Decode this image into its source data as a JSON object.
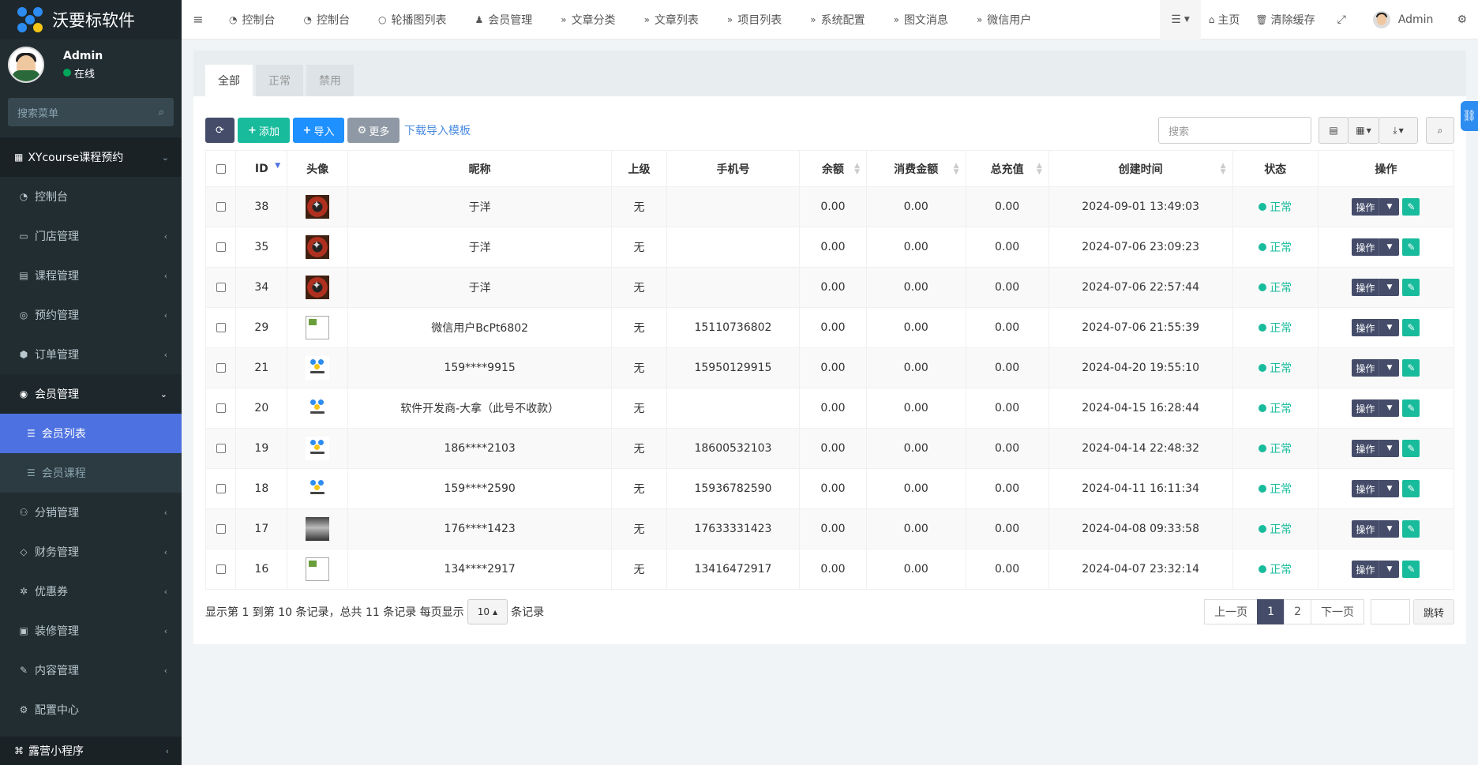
{
  "app": {
    "title": "沃要标软件"
  },
  "user": {
    "name": "Admin",
    "status": "在线"
  },
  "sidebar": {
    "search_placeholder": "搜索菜单",
    "header": "XYcourse课程预约",
    "items": [
      {
        "label": "控制台",
        "icon": "dashboard-icon"
      },
      {
        "label": "门店管理",
        "icon": "store-icon"
      },
      {
        "label": "课程管理",
        "icon": "book-icon"
      },
      {
        "label": "预约管理",
        "icon": "whatsapp-icon"
      },
      {
        "label": "订单管理",
        "icon": "cube-icon"
      },
      {
        "label": "会员管理",
        "icon": "user-circle-icon"
      }
    ],
    "sub_items": [
      {
        "label": "会员列表",
        "icon": "list-icon"
      },
      {
        "label": "会员课程",
        "icon": "list-icon"
      }
    ],
    "items2": [
      {
        "label": "分销管理",
        "icon": "users-icon"
      },
      {
        "label": "财务管理",
        "icon": "diamond-icon"
      },
      {
        "label": "优惠券",
        "icon": "ticket-icon"
      },
      {
        "label": "装修管理",
        "icon": "image-icon"
      },
      {
        "label": "内容管理",
        "icon": "edit-icon"
      },
      {
        "label": "配置中心",
        "icon": "gear-icon"
      }
    ],
    "footer": "露营小程序"
  },
  "topnav": {
    "tabs": [
      "控制台",
      "控制台",
      "轮播图列表",
      "会员管理",
      "文章分类",
      "文章列表",
      "项目列表",
      "系统配置",
      "图文消息",
      "微信用户"
    ],
    "home": "主页",
    "clear_cache": "清除缓存",
    "admin": "Admin"
  },
  "panel": {
    "tabs": [
      "全部",
      "正常",
      "禁用"
    ],
    "toolbar": {
      "add": "添加",
      "import": "导入",
      "more": "更多",
      "download_template": "下载导入模板",
      "search_placeholder": "搜索"
    }
  },
  "table": {
    "headers": [
      "ID",
      "头像",
      "昵称",
      "上级",
      "手机号",
      "余额",
      "消费金额",
      "总充值",
      "创建时间",
      "状态",
      "操作"
    ],
    "op_label": "操作",
    "rows": [
      {
        "id": "38",
        "avatar": "benz",
        "nickname": "于洋",
        "parent": "无",
        "phone": "",
        "balance": "0.00",
        "spent": "0.00",
        "recharge": "0.00",
        "created": "2024-09-01 13:49:03",
        "status": "正常"
      },
      {
        "id": "35",
        "avatar": "benz",
        "nickname": "于洋",
        "parent": "无",
        "phone": "",
        "balance": "0.00",
        "spent": "0.00",
        "recharge": "0.00",
        "created": "2024-07-06 23:09:23",
        "status": "正常"
      },
      {
        "id": "34",
        "avatar": "benz",
        "nickname": "于洋",
        "parent": "无",
        "phone": "",
        "balance": "0.00",
        "spent": "0.00",
        "recharge": "0.00",
        "created": "2024-07-06 22:57:44",
        "status": "正常"
      },
      {
        "id": "29",
        "avatar": "broken",
        "nickname": "微信用户BcPt6802",
        "parent": "无",
        "phone": "15110736802",
        "balance": "0.00",
        "spent": "0.00",
        "recharge": "0.00",
        "created": "2024-07-06 21:55:39",
        "status": "正常"
      },
      {
        "id": "21",
        "avatar": "logo",
        "nickname": "159****9915",
        "parent": "无",
        "phone": "15950129915",
        "balance": "0.00",
        "spent": "0.00",
        "recharge": "0.00",
        "created": "2024-04-20 19:55:10",
        "status": "正常"
      },
      {
        "id": "20",
        "avatar": "logo",
        "nickname": "软件开发商-大拿（此号不收款）",
        "parent": "无",
        "phone": "",
        "balance": "0.00",
        "spent": "0.00",
        "recharge": "0.00",
        "created": "2024-04-15 16:28:44",
        "status": "正常"
      },
      {
        "id": "19",
        "avatar": "logo",
        "nickname": "186****2103",
        "parent": "无",
        "phone": "18600532103",
        "balance": "0.00",
        "spent": "0.00",
        "recharge": "0.00",
        "created": "2024-04-14 22:48:32",
        "status": "正常"
      },
      {
        "id": "18",
        "avatar": "logo",
        "nickname": "159****2590",
        "parent": "无",
        "phone": "15936782590",
        "balance": "0.00",
        "spent": "0.00",
        "recharge": "0.00",
        "created": "2024-04-11 16:11:34",
        "status": "正常"
      },
      {
        "id": "17",
        "avatar": "photo",
        "nickname": "176****1423",
        "parent": "无",
        "phone": "17633331423",
        "balance": "0.00",
        "spent": "0.00",
        "recharge": "0.00",
        "created": "2024-04-08 09:33:58",
        "status": "正常"
      },
      {
        "id": "16",
        "avatar": "broken",
        "nickname": "134****2917",
        "parent": "无",
        "phone": "13416472917",
        "balance": "0.00",
        "spent": "0.00",
        "recharge": "0.00",
        "created": "2024-04-07 23:32:14",
        "status": "正常"
      }
    ]
  },
  "footer": {
    "summary_before": "显示第 1 到第 10 条记录，总共 11 条记录 每页显示",
    "page_size": "10",
    "summary_after": "条记录",
    "prev": "上一页",
    "pages": [
      "1",
      "2"
    ],
    "next": "下一页",
    "go": "跳转"
  },
  "colors": {
    "primary": "#444c69",
    "success": "#18bc9c",
    "info": "#1e90ff",
    "sidebar": "#222d32",
    "active_menu": "#4d71e0"
  }
}
